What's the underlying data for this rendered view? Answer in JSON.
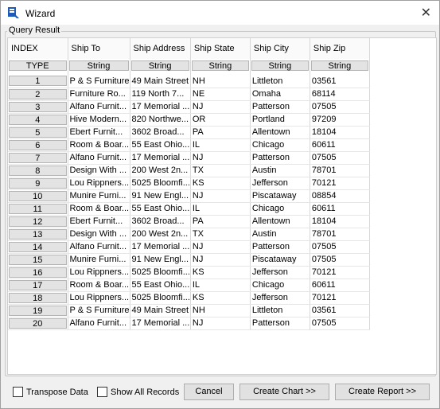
{
  "window": {
    "title": "Wizard",
    "close_glyph": "✕",
    "icon": "wizard-app-icon"
  },
  "group": {
    "legend": "Query Result"
  },
  "table": {
    "columns": [
      "INDEX",
      "Ship To",
      "Ship Address",
      "Ship State",
      "Ship City",
      "Ship Zip"
    ],
    "types": [
      "TYPE",
      "String",
      "String",
      "String",
      "String",
      "String"
    ],
    "rows": [
      [
        "1",
        "P & S Furniture",
        "49 Main Street",
        "NH",
        "Littleton",
        "03561"
      ],
      [
        "2",
        "Furniture Ro...",
        "119 North 7...",
        "NE",
        "Omaha",
        "68114"
      ],
      [
        "3",
        "Alfano Furnit...",
        "17 Memorial ...",
        "NJ",
        "Patterson",
        "07505"
      ],
      [
        "4",
        "Hive Modern...",
        "820 Northwe...",
        "OR",
        "Portland",
        "97209"
      ],
      [
        "5",
        "Ebert Furnit...",
        "3602 Broad...",
        "PA",
        "Allentown",
        "18104"
      ],
      [
        "6",
        "Room & Boar...",
        "55 East Ohio...",
        "IL",
        "Chicago",
        "60611"
      ],
      [
        "7",
        "Alfano Furnit...",
        "17 Memorial ...",
        "NJ",
        "Patterson",
        "07505"
      ],
      [
        "8",
        "Design With ...",
        "200 West 2n...",
        "TX",
        "Austin",
        "78701"
      ],
      [
        "9",
        "Lou Rippners...",
        "5025 Bloomfi...",
        "KS",
        "Jefferson",
        "70121"
      ],
      [
        "10",
        "Munire Furni...",
        "91 New Engl...",
        "NJ",
        "Piscataway",
        "08854"
      ],
      [
        "11",
        "Room & Boar...",
        "55 East Ohio...",
        "IL",
        "Chicago",
        "60611"
      ],
      [
        "12",
        "Ebert Furnit...",
        "3602 Broad...",
        "PA",
        "Allentown",
        "18104"
      ],
      [
        "13",
        "Design With ...",
        "200 West 2n...",
        "TX",
        "Austin",
        "78701"
      ],
      [
        "14",
        "Alfano Furnit...",
        "17 Memorial ...",
        "NJ",
        "Patterson",
        "07505"
      ],
      [
        "15",
        "Munire Furni...",
        "91 New Engl...",
        "NJ",
        "Piscataway",
        "07505"
      ],
      [
        "16",
        "Lou Rippners...",
        "5025 Bloomfi...",
        "KS",
        "Jefferson",
        "70121"
      ],
      [
        "17",
        "Room & Boar...",
        "55 East Ohio...",
        "IL",
        "Chicago",
        "60611"
      ],
      [
        "18",
        "Lou Rippners...",
        "5025 Bloomfi...",
        "KS",
        "Jefferson",
        "70121"
      ],
      [
        "19",
        "P & S Furniture",
        "49 Main Street",
        "NH",
        "Littleton",
        "03561"
      ],
      [
        "20",
        "Alfano Furnit...",
        "17 Memorial ...",
        "NJ",
        "Patterson",
        "07505"
      ]
    ]
  },
  "footer": {
    "transpose_label": "Transpose Data",
    "transpose_checked": false,
    "show_all_label": "Show All Records",
    "show_all_checked": false,
    "cancel_label": "Cancel",
    "create_chart_label": "Create Chart >>",
    "create_report_label": "Create Report >>"
  }
}
